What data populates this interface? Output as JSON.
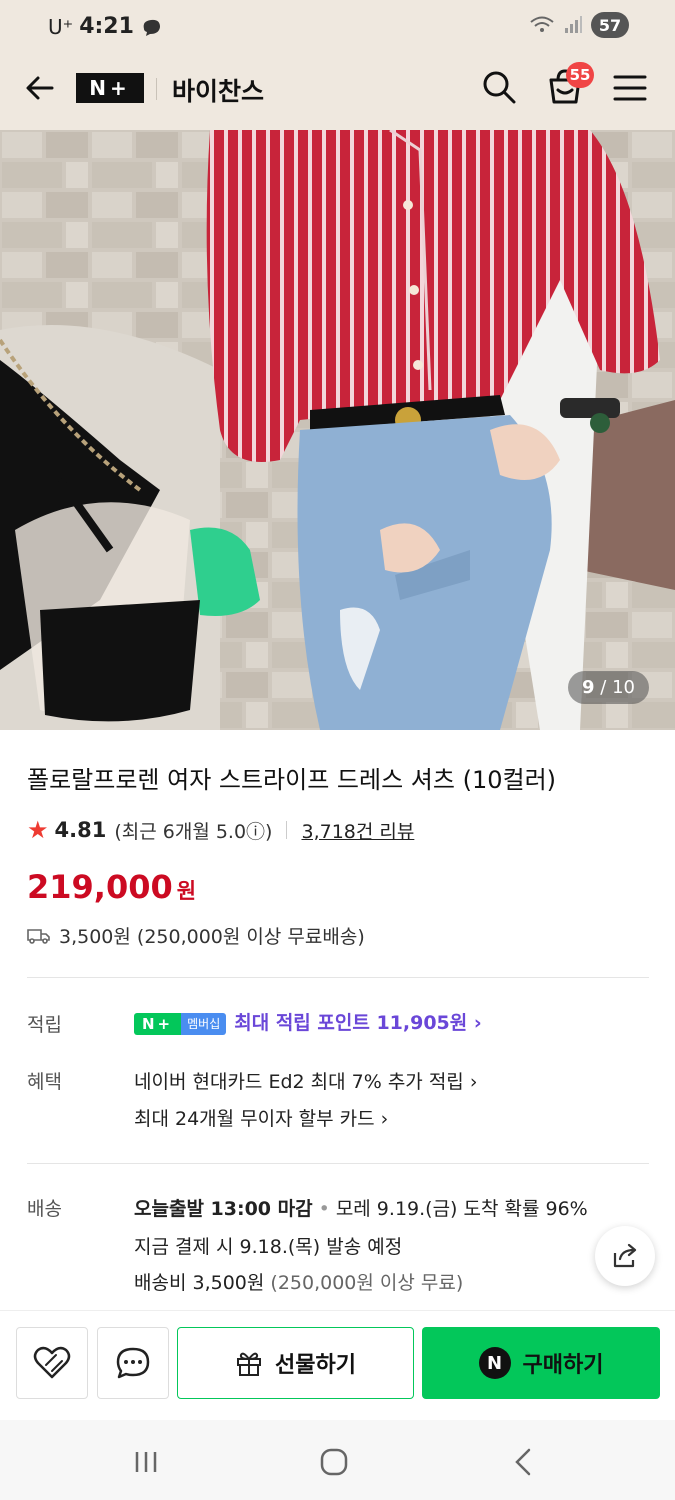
{
  "status": {
    "carrier": "U⁺",
    "time": "4:21",
    "battery": "57"
  },
  "header": {
    "logo": "N+",
    "store_name": "바이찬스",
    "cart_count": "55"
  },
  "gallery": {
    "current": "9",
    "total": "/ 10"
  },
  "product": {
    "title": "폴로랄프로렌 여자 스트라이프 드레스 셔츠 (10컬러)",
    "rating": "4.81",
    "recent_rating": "(최근 6개월 5.0ⓘ)",
    "review_count": "3,718건 리뷰",
    "price": "219,000",
    "price_unit": "원",
    "shipping": "3,500원 (250,000원 이상 무료배송)"
  },
  "points": {
    "label": "적립",
    "badge_n": "N+",
    "badge_member": "멤버십",
    "text": "최대 적립 포인트 11,905원 ›"
  },
  "benefits": {
    "label": "혜택",
    "items": [
      "네이버 현대카드 Ed2 최대 7% 추가 적립 ›",
      "최대 24개월 무이자 할부 카드 ›"
    ]
  },
  "delivery": {
    "label": "배송",
    "deadline": "오늘출발 13:00 마감",
    "dot": "•",
    "arrival": "모레 9.19.(금) 도착 확률 96%",
    "ship_date": "지금 결제 시 9.18.(목) 발송 예정",
    "fee": "배송비 3,500원",
    "fee_note": "(250,000원 이상 무료)"
  },
  "actions": {
    "gift": "선물하기",
    "buy": "구매하기",
    "buy_icon": "N"
  },
  "colors": {
    "naver_green": "#03c75a",
    "price_red": "#cc0a22",
    "point_purple": "#6a47d8",
    "header_bg": "#efe8df"
  }
}
